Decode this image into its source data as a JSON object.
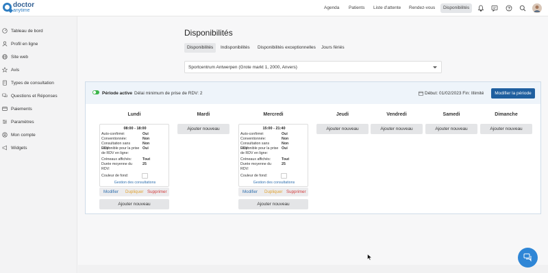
{
  "brand": {
    "name": "doctor",
    "sub": "anytime"
  },
  "topnav": {
    "items": [
      "Agenda",
      "Patients",
      "Liste d'attente",
      "Rendez-vous",
      "Disponibilités"
    ],
    "active": "Disponibilités"
  },
  "sidebar": {
    "items": [
      "Tableau de bord",
      "Profil en ligne",
      "Site web",
      "Avis",
      "Types de consultation",
      "Questions et Réponses",
      "Paiements",
      "Paramètres",
      "Mon compte",
      "Widgets"
    ]
  },
  "page": {
    "title": "Disponibilités",
    "tabs": [
      "Disponibilités",
      "Indisponibilités",
      "Disponibilités exceptionnelles",
      "Jours fériés"
    ],
    "active_tab": "Disponibilités"
  },
  "location_select": {
    "value": "Sportcentrum Antwerpen (Grote markt 1, 2000, Anvers)"
  },
  "period": {
    "status": "Période active",
    "delay": "Délai minimum de prise de RDV: 2",
    "dates": "Début: 01/02/2023 Fin: Illimité",
    "edit_button": "Modifier la période",
    "toggle_on": true
  },
  "days": [
    "Lundi",
    "Mardi",
    "Mercredi",
    "Jeudi",
    "Vendredi",
    "Samedi",
    "Dimanche"
  ],
  "add_button": "Ajouter nouveau",
  "slot_labels": {
    "auto": "Auto-confirmé:",
    "conv": "Conventionnée:",
    "sans": "Consultation sans RDV:",
    "dispo1": "Disponible pour la prise",
    "dispo2": "de RDV en ligne:",
    "creneaux": "Créneaux affichés:",
    "duree1": "Durée moyenne du",
    "duree2": "RDV:",
    "fond": "Couleur de fond:",
    "link": "Gestion des consultations"
  },
  "slots": {
    "lundi": {
      "time": "08:00 - 18:00",
      "auto": "Oui",
      "conv": "Non",
      "sans": "Non",
      "dispo": "Oui",
      "creneaux": "Tout",
      "duree": "25"
    },
    "mercredi": {
      "time": "15:00 - 21:40",
      "auto": "Oui",
      "conv": "Non",
      "sans": "Non",
      "dispo": "Oui",
      "creneaux": "Tout",
      "duree": "25"
    }
  },
  "slot_actions": {
    "modify": "Modifier",
    "duplicate": "Dupliquer",
    "delete": "Supprimer"
  },
  "colors": {
    "primary": "#1f5f9f",
    "active_toggle": "#3bb54a",
    "link": "#2f6fae",
    "duplicate": "#e0a12f",
    "delete": "#d23c3c"
  }
}
